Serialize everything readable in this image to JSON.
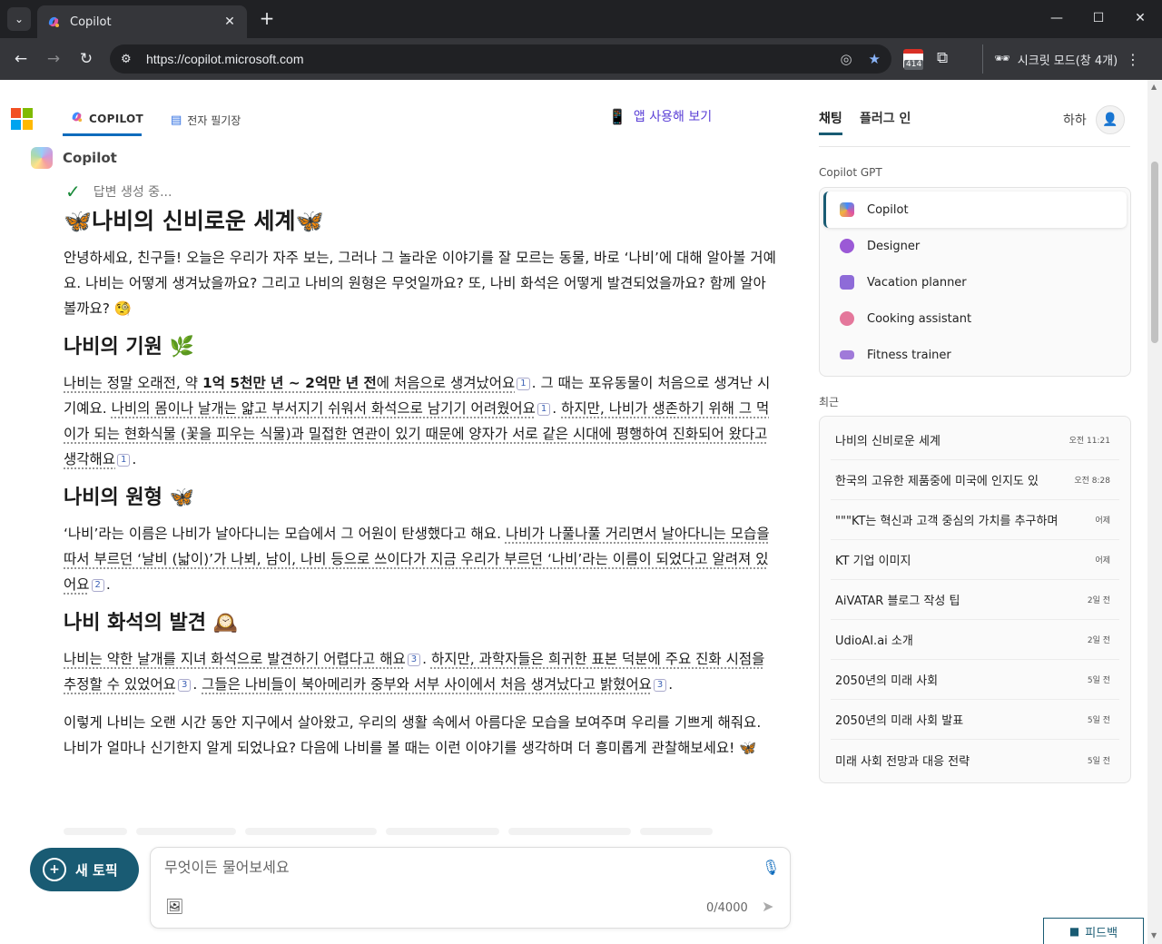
{
  "browser": {
    "tab_title": "Copilot",
    "url": "https://copilot.microsoft.com",
    "incognito_label": "시크릿 모드(창 4개)",
    "calendar_badge": "414"
  },
  "header": {
    "nav_copilot": "COPILOT",
    "nav_notebook": "전자 필기장",
    "app_link": "앱 사용해 보기"
  },
  "conversation": {
    "bot_name": "Copilot",
    "status": "답변 생성 중...",
    "title": "🦋나비의 신비로운 세계🦋",
    "intro": "안녕하세요, 친구들! 오늘은 우리가 자주 보는, 그러나 그 놀라운 이야기를 잘 모르는 동물, 바로 ‘나비’에 대해 알아볼 거예요. 나비는 어떻게 생겨났을까요? 그리고 나비의 원형은 무엇일까요? 또, 나비 화석은 어떻게 발견되었을까요? 함께 알아볼까요? 🧐",
    "section1_heading": "나비의 기원 🌿",
    "section1_p1a": "나비는 정말 오래전, 약 ",
    "section1_p1b": "1억 5천만 년 ~ 2억만 년 전",
    "section1_p1c": "에 처음으로 생겨났어요",
    "section1_p2": ". 그 때는 포유동물이 처음으로 생겨난 시기예요. ",
    "section1_p3": "나비의 몸이나 날개는 얇고 부서지기 쉬워서 화석으로 남기기 어려웠어요",
    "section1_p4": ". ",
    "section1_p5": "하지만, 나비가 생존하기 위해 그 먹이가 되는 현화식물 (꽃을 피우는 식물)과 밀접한 연관이 있기 때문에 양자가 서로 같은 시대에 평행하여 진화되어 왔다고 생각해요",
    "section2_heading": "나비의 원형 🦋",
    "section2_p1": "‘나비’라는 이름은 나비가 날아다니는 모습에서 그 어원이 탄생했다고 해요. ",
    "section2_p2": "나비가 나풀나풀 거리면서 날아다니는 모습을 따서 부르던 ‘날비 (낣이)’가 나뵈, 남이, 나비 등으로 쓰이다가 지금 우리가 부르던 ‘나비’라는 이름이 되었다고 알려져 있어요",
    "section3_heading": "나비 화석의 발견 🕰️",
    "section3_p1": "나비는 약한 날개를 지녀 화석으로 발견하기 어렵다고 해요",
    "section3_p2": ". ",
    "section3_p3": "하지만, 과학자들은 희귀한 표본 덕분에 주요 진화 시점을 추정할 수 있었어요",
    "section3_p4": "그들은 나비들이 북아메리카 중부와 서부 사이에서 처음 생겨났다고 밝혔어요",
    "closing": "이렇게 나비는 오랜 시간 동안 지구에서 살아왔고, 우리의 생활 속에서 아름다운 모습을 보여주며 우리를 기쁘게 해줘요. 나비가 얼마나 신기한지 알게 되었나요? 다음에 나비를 볼 때는 이런 이야기를 생각하며 더 흥미롭게 관찰해보세요! 🦋",
    "cite1": "1",
    "cite2": "2",
    "cite3": "3",
    "period": "."
  },
  "composer": {
    "new_topic": "새 토픽",
    "placeholder": "무엇이든 물어보세요",
    "counter": "0/4000"
  },
  "sidebar": {
    "tab_chat": "채팅",
    "tab_plugins": "플러그 인",
    "user_name": "하하",
    "gpt_section": "Copilot GPT",
    "gpts": [
      {
        "label": "Copilot",
        "color": "#7a6cf0"
      },
      {
        "label": "Designer",
        "color": "#9b59d6"
      },
      {
        "label": "Vacation planner",
        "color": "#8e6bd8"
      },
      {
        "label": "Cooking assistant",
        "color": "#e4779b"
      },
      {
        "label": "Fitness trainer",
        "color": "#a07ad9"
      }
    ],
    "recent_section": "최근",
    "recent": [
      {
        "title": "나비의 신비로운 세계",
        "time": "오전 11:21"
      },
      {
        "title": "한국의 고유한 제품중에 미국에 인지도 있",
        "time": "오전 8:28"
      },
      {
        "title": "\"\"\"KT는 혁신과 고객 중심의 가치를 추구하며",
        "time": "어제"
      },
      {
        "title": "KT 기업 이미지",
        "time": "어제"
      },
      {
        "title": "AiVATAR 블로그 작성 팁",
        "time": "2일 전"
      },
      {
        "title": "UdioAI.ai 소개",
        "time": "2일 전"
      },
      {
        "title": "2050년의 미래 사회",
        "time": "5일 전"
      },
      {
        "title": "2050년의 미래 사회 발표",
        "time": "5일 전"
      },
      {
        "title": "미래 사회 전망과 대응 전략",
        "time": "5일 전"
      }
    ],
    "feedback": "피드백"
  }
}
